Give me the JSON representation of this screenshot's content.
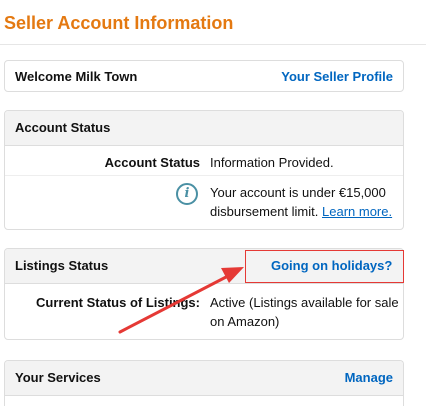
{
  "page": {
    "title": "Seller Account Information"
  },
  "welcome": {
    "text": "Welcome Milk Town",
    "profile_link": "Your Seller Profile"
  },
  "account_status": {
    "header": "Account Status",
    "label": "Account Status",
    "value": "Information Provided.",
    "notice_line1": "Your account is under €15,000",
    "notice_line2": "disbursement limit.",
    "learn_more": "Learn more."
  },
  "listings_status": {
    "header": "Listings Status",
    "holidays_link": "Going on holidays?",
    "label": "Current Status of Listings:",
    "value_line1": "Active (Listings available for sale",
    "value_line2": "on Amazon)"
  },
  "services": {
    "header": "Your Services",
    "manage_link": "Manage"
  },
  "colors": {
    "title_orange": "#e47911",
    "link_blue": "#0066c0",
    "annotation_red": "#e53935",
    "info_icon": "#4a90a4"
  },
  "icons": {
    "info": "info-icon",
    "annotation_arrow": "red-arrow-icon"
  }
}
